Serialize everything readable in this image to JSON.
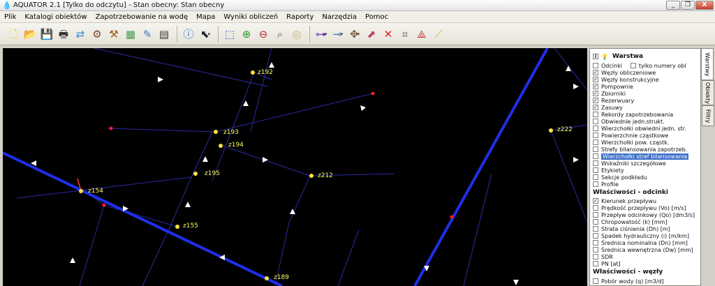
{
  "title": "AQUATOR 2.1 [Tylko do odczytu] - Stan obecny: Stan obecny",
  "window_buttons": [
    "_",
    "❐",
    "X"
  ],
  "menu": [
    "Plik",
    "Katalogi obiektów",
    "Zapotrzebowanie na wodę",
    "Mapa",
    "Wyniki obliczeń",
    "Raporty",
    "Narzędzia",
    "Pomoc"
  ],
  "toolbar_icons": [
    "new-file-icon",
    "open-folder-icon",
    "save-icon",
    "print-icon",
    "refresh-arrows-icon",
    "pipe-network-icon",
    "valve-icon",
    "map-icon",
    "edit-map-icon",
    "calculator-icon",
    "info-icon",
    "select-arrow-icon",
    "select-area-icon",
    "zoom-in-icon",
    "zoom-out-icon",
    "zoom-fit-icon",
    "zoom-window-icon",
    "add-node-icon",
    "add-pipe-icon",
    "move-node-icon",
    "transform-icon",
    "delete-icon",
    "grid-snap-icon",
    "measure-icon",
    "ruler-icon"
  ],
  "node_labels": [
    "z192",
    "z193",
    "z194",
    "z195",
    "z212",
    "z154",
    "z155",
    "z189",
    "z222"
  ],
  "panel": {
    "header": "Warstwa",
    "layers": [
      {
        "label": "Odcinki",
        "checked": false,
        "extra": "tylko numery obl"
      },
      {
        "label": "Węzły obliczeniowe",
        "checked": true
      },
      {
        "label": "Węzły konstrukcyjne",
        "checked": true
      },
      {
        "label": "Pompownie",
        "checked": true
      },
      {
        "label": "Zbiorniki",
        "checked": true
      },
      {
        "label": "Rezerwuary",
        "checked": true
      },
      {
        "label": "Zasuwy",
        "checked": true
      },
      {
        "label": "Rekordy zapotrzebowania",
        "checked": false
      },
      {
        "label": "Obwiednie jedn.strukt.",
        "checked": false
      },
      {
        "label": "Wierzchołki obwiedni jedn. str.",
        "checked": false
      },
      {
        "label": "Powierzchnie cząstkowe",
        "checked": false
      },
      {
        "label": "Wierzchołki pow. cząstk.",
        "checked": false
      },
      {
        "label": "Strefy bilansowania zapotrzeb.",
        "checked": false
      },
      {
        "label": "Wierzchołki stref bilansowania",
        "checked": false,
        "highlighted": true
      },
      {
        "label": "Wskaźniki szczegółowe",
        "checked": false
      },
      {
        "label": "Etykiety",
        "checked": false
      },
      {
        "label": "Sekcje podkładu",
        "checked": false
      },
      {
        "label": "Profile",
        "checked": false
      }
    ],
    "section_odcinki": "Właściwości - odcinki",
    "odcinki_props": [
      {
        "label": "Kierunek przepływu",
        "checked": true
      },
      {
        "label": "Prędkość przepływu (Vo) [m/s]",
        "checked": false
      },
      {
        "label": "Przepływ odcinkowy (Qo) [dm3/s]",
        "checked": false
      },
      {
        "label": "Chropowatość (k) [mm]",
        "checked": false
      },
      {
        "label": "Strata ciśnienia (Dh) [m]",
        "checked": false
      },
      {
        "label": "Spadek hydrauliczny (i) [m/km]",
        "checked": false
      },
      {
        "label": "Średnica nominalna (Dn) [mm]",
        "checked": false
      },
      {
        "label": "Średnica wewnętrzna (Dw) [mm]",
        "checked": false
      },
      {
        "label": "SDR",
        "checked": false
      },
      {
        "label": "PN [at]",
        "checked": false
      }
    ],
    "section_wezly": "Właściwości - węzły",
    "wezly_props": [
      {
        "label": "Pobór wody (q) [m3/d]",
        "checked": false
      }
    ]
  },
  "side_tabs": [
    "Warstwy",
    "Obiekty",
    "Filtry"
  ]
}
